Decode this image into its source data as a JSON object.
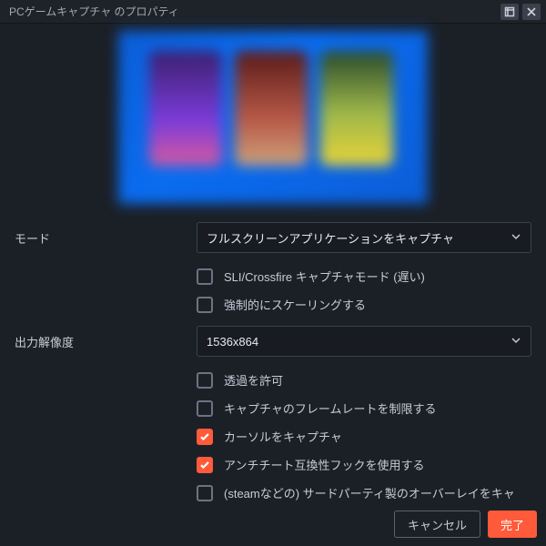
{
  "window": {
    "title": "PCゲームキャプチャ のプロパティ"
  },
  "form": {
    "mode_label": "モード",
    "mode_value": "フルスクリーンアプリケーションをキャプチャ",
    "mode_checks": [
      {
        "label": "SLI/Crossfire キャプチャモード (遅い)",
        "checked": false
      },
      {
        "label": "強制的にスケーリングする",
        "checked": false
      }
    ],
    "res_label": "出力解像度",
    "res_value": "1536x864",
    "res_checks": [
      {
        "label": "透過を許可",
        "checked": false
      },
      {
        "label": "キャプチャのフレームレートを制限する",
        "checked": false
      },
      {
        "label": "カーソルをキャプチャ",
        "checked": true
      },
      {
        "label": "アンチチート互換性フックを使用する",
        "checked": true
      },
      {
        "label": "(steamなどの) サードパーティ製のオーバーレイをキャ",
        "checked": false
      }
    ]
  },
  "footer": {
    "cancel": "キャンセル",
    "ok": "完了"
  }
}
